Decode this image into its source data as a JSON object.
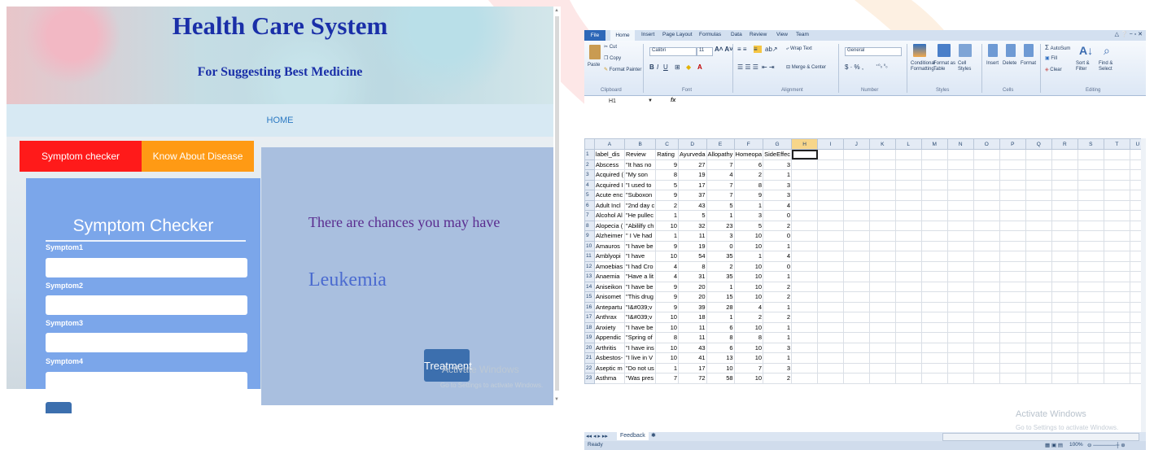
{
  "app": {
    "title": "Health Care System",
    "subtitle": "For Suggesting Best Medicine",
    "nav_home": "HOME",
    "tabs": [
      "Symptom checker",
      "Know About Disease"
    ],
    "form": {
      "title": "Symptom Checker",
      "fields": [
        "Symptom1",
        "Symptom2",
        "Symptom3",
        "Symptom4"
      ]
    },
    "result": {
      "text": "There are chances you may have",
      "disease": "Leukemia",
      "button": "Treatment"
    }
  },
  "watermark": {
    "line1": "Activate Windows",
    "line2": "Go to Settings to activate Windows."
  },
  "excel": {
    "menu": [
      "File",
      "Home",
      "Insert",
      "Page Layout",
      "Formulas",
      "Data",
      "Review",
      "View",
      "Team"
    ],
    "clipboard": {
      "cut": "Cut",
      "copy": "Copy",
      "paste": "Paste",
      "format_painter": "Format Painter",
      "group": "Clipboard"
    },
    "font": {
      "name": "Calibri",
      "size": "11",
      "group": "Font"
    },
    "alignment": {
      "wrap": "Wrap Text",
      "merge": "Merge & Center",
      "group": "Alignment"
    },
    "number": {
      "format": "General",
      "group": "Number"
    },
    "styles": {
      "cond": "Conditional Formatting",
      "table": "Format as Table",
      "cell": "Cell Styles",
      "group": "Styles"
    },
    "cells": {
      "insert": "Insert",
      "delete": "Delete",
      "format": "Format",
      "group": "Cells"
    },
    "editing": {
      "autosum": "AutoSum",
      "fill": "Fill",
      "clear": "Clear",
      "sort": "Sort & Filter",
      "find": "Find & Select",
      "group": "Editing"
    },
    "name_box": "H1",
    "fx": "fx",
    "columns": [
      "A",
      "B",
      "C",
      "D",
      "E",
      "F",
      "G",
      "H",
      "I",
      "J",
      "K",
      "L",
      "M",
      "N",
      "O",
      "P",
      "Q",
      "R",
      "S",
      "T",
      "U"
    ],
    "header_row": [
      "label_dis",
      "Review",
      "Rating",
      "Ayurveda",
      "Allopathy",
      "Homeopa",
      "SideEffec"
    ],
    "rows": [
      [
        "Abscess",
        "\"It has no",
        "9",
        "27",
        "7",
        "6",
        "3"
      ],
      [
        "Acquired (",
        "\"My son",
        "8",
        "19",
        "4",
        "2",
        "1"
      ],
      [
        "Acquired I",
        "\"I used to",
        "5",
        "17",
        "7",
        "8",
        "3"
      ],
      [
        "Acute enc",
        "\"Suboxon",
        "9",
        "37",
        "7",
        "9",
        "3"
      ],
      [
        "Adult Incl",
        "\"2nd day c",
        "2",
        "43",
        "5",
        "1",
        "4"
      ],
      [
        "Alcohol Al",
        "\"He pullec",
        "1",
        "5",
        "1",
        "3",
        "0"
      ],
      [
        "Alopecia (",
        "\"Abililfy ch",
        "10",
        "32",
        "23",
        "5",
        "2"
      ],
      [
        "Alzheimer",
        "\" I Ve had",
        "1",
        "11",
        "3",
        "10",
        "0"
      ],
      [
        "Amauros",
        "\"I have be",
        "9",
        "19",
        "0",
        "10",
        "1"
      ],
      [
        "Amblyopi",
        "\"I have",
        "10",
        "54",
        "35",
        "1",
        "4"
      ],
      [
        "Amoebias",
        "\"I had Cro",
        "4",
        "8",
        "2",
        "10",
        "0"
      ],
      [
        "Anaemia",
        "\"Have a lit",
        "4",
        "31",
        "35",
        "10",
        "1"
      ],
      [
        "Aniseikon",
        "\"I have be",
        "9",
        "20",
        "1",
        "10",
        "2"
      ],
      [
        "Anisomet",
        "\"This drug",
        "9",
        "20",
        "15",
        "10",
        "2"
      ],
      [
        "Antepartu",
        "\"I&#039;v",
        "9",
        "39",
        "28",
        "4",
        "1"
      ],
      [
        "Anthrax",
        "\"I&#039;v",
        "10",
        "18",
        "1",
        "2",
        "2"
      ],
      [
        "Anxiety",
        "\"I have be",
        "10",
        "11",
        "6",
        "10",
        "1"
      ],
      [
        "Appendic",
        "\"Spring of",
        "8",
        "11",
        "8",
        "8",
        "1"
      ],
      [
        "Arthritis",
        "\"I have ins",
        "10",
        "43",
        "6",
        "10",
        "3"
      ],
      [
        "Asbestos-",
        "\"I live in V",
        "10",
        "41",
        "13",
        "10",
        "1"
      ],
      [
        "Aseptic m",
        "\"Do not us",
        "1",
        "17",
        "10",
        "7",
        "3"
      ],
      [
        "Asthma",
        "\"Was pres",
        "7",
        "72",
        "58",
        "10",
        "2"
      ]
    ],
    "sheet_tab": "Feedback",
    "status": "Ready",
    "zoom": "100%"
  }
}
